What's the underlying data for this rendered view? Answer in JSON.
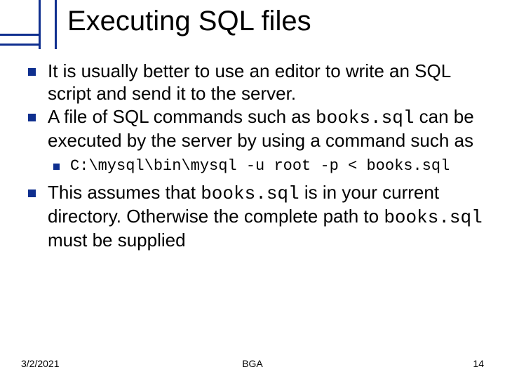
{
  "title": "Executing SQL files",
  "bullets": {
    "b1_a": "It is usually better to use an editor to write an SQL script and send it to the server.",
    "b2_a": "A file of SQL commands such as ",
    "b2_code": "books.sql",
    "b2_b": " can be executed by the server by using a command such as",
    "b2_sub": "C:\\mysql\\bin\\mysql -u root -p < books.sql",
    "b3_a": "This assumes that ",
    "b3_code1": "books.sql",
    "b3_b": " is in your current directory. Otherwise the complete path to ",
    "b3_code2": "books.sql",
    "b3_c": " must be supplied"
  },
  "footer": {
    "date": "3/2/2021",
    "center": "BGA",
    "page": "14"
  }
}
